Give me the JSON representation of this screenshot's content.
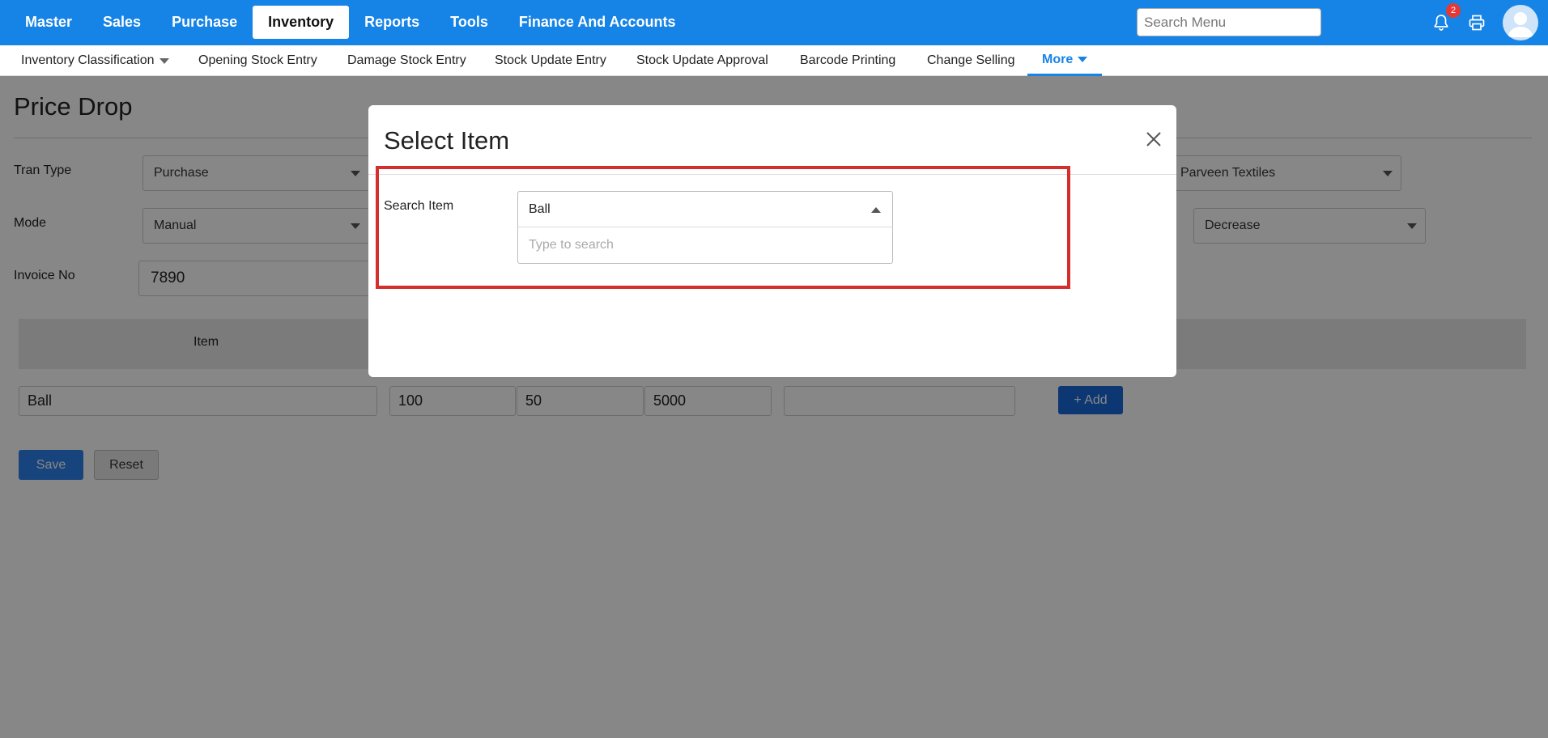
{
  "topnav": {
    "items": [
      {
        "label": "Master"
      },
      {
        "label": "Sales"
      },
      {
        "label": "Purchase"
      },
      {
        "label": "Inventory",
        "active": true
      },
      {
        "label": "Reports"
      },
      {
        "label": "Tools"
      },
      {
        "label": "Finance And Accounts"
      }
    ],
    "search_placeholder": "Search Menu",
    "notification_count": "2"
  },
  "subnav": {
    "items": [
      {
        "label": "Inventory Classification"
      },
      {
        "label": "Opening Stock Entry"
      },
      {
        "label": "Damage Stock Entry"
      },
      {
        "label": "Stock Update Entry"
      },
      {
        "label": "Stock Update Approval"
      },
      {
        "label": "Barcode Printing"
      },
      {
        "label": "Change Selling"
      },
      {
        "label": "More"
      }
    ]
  },
  "page": {
    "title": "Price Drop",
    "tran_type": {
      "label": "Tran Type",
      "value": "Purchase"
    },
    "mode": {
      "label": "Mode",
      "value": "Manual"
    },
    "invoice": {
      "label": "Invoice No",
      "value": "7890"
    },
    "supplier_value": "Parveen Textiles",
    "adjust_value": "Decrease",
    "grid": {
      "header_item": "Item",
      "row": {
        "item": "Ball",
        "col2": "100",
        "col3": "50",
        "col4": "5000",
        "col5": ""
      },
      "add_label": "+ Add"
    },
    "save_label": "Save",
    "reset_label": "Reset"
  },
  "modal": {
    "title": "Select Item",
    "search_label": "Search Item",
    "selected_value": "Ball",
    "search_placeholder": "Type to search"
  },
  "colors": {
    "primary": "#1683e6",
    "highlight": "#d32f2f"
  }
}
